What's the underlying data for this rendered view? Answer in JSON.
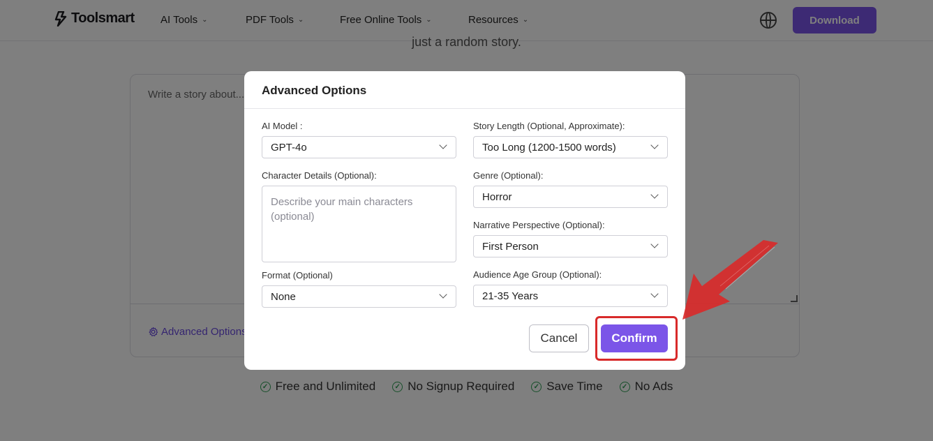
{
  "navbar": {
    "logo_text": "Toolsmart",
    "items": [
      {
        "label": "AI Tools"
      },
      {
        "label": "PDF Tools"
      },
      {
        "label": "Free Online Tools"
      },
      {
        "label": "Resources"
      }
    ],
    "download_label": "Download",
    "icons": {
      "logo": "bolt-logo-icon",
      "language": "globe-icon",
      "chevron": "chevron-down-icon"
    }
  },
  "page": {
    "tagline": "just a random story.",
    "story_placeholder": "Write a story about...",
    "advanced_options_label": "Advanced Options",
    "features": [
      {
        "label": "Free and Unlimited"
      },
      {
        "label": "No Signup Required"
      },
      {
        "label": "Save Time"
      },
      {
        "label": "No Ads"
      }
    ]
  },
  "modal": {
    "title": "Advanced Options",
    "ai_model": {
      "label": "AI Model :",
      "value": "GPT-4o"
    },
    "story_length": {
      "label": "Story Length (Optional, Approximate):",
      "value": "Too Long (1200-1500 words)"
    },
    "character_details": {
      "label": "Character Details (Optional):",
      "placeholder": "Describe your main characters (optional)"
    },
    "genre": {
      "label": "Genre (Optional):",
      "value": "Horror"
    },
    "narrative_perspective": {
      "label": "Narrative Perspective (Optional):",
      "value": "First Person"
    },
    "format": {
      "label": "Format (Optional)",
      "value": "None"
    },
    "audience_age": {
      "label": "Audience Age Group (Optional):",
      "value": "21-35 Years"
    },
    "cancel_label": "Cancel",
    "confirm_label": "Confirm"
  },
  "colors": {
    "accent": "#7b55e8",
    "annotation_red": "#d82a2a",
    "check_green": "#2f9e55"
  }
}
